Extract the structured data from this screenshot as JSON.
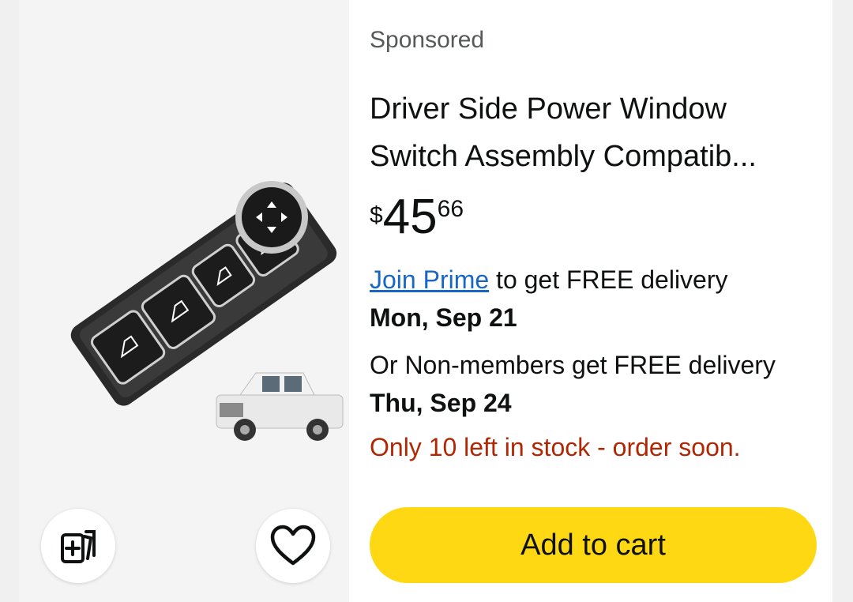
{
  "sponsored_label": "Sponsored",
  "product": {
    "title": "Driver Side Power Window Switch Assembly Compatib...",
    "price": {
      "symbol": "$",
      "whole": "45",
      "fraction": "66"
    },
    "image_alt": "Power window switch assembly"
  },
  "delivery": {
    "join_prime_link": "Join Prime",
    "prime_text": " to get FREE delivery",
    "prime_date": "Mon, Sep 21",
    "non_member_text": "Or Non-members get FREE delivery ",
    "non_member_date": "Thu, Sep 24"
  },
  "stock_message": "Only 10 left in stock - order soon.",
  "buttons": {
    "add_to_cart": "Add to cart",
    "compare_icon": "compare-cards-icon",
    "wishlist_icon": "heart-icon"
  },
  "colors": {
    "cart_button": "#ffd814",
    "link": "#1a66c4",
    "stock_warning": "#b12704",
    "image_background": "#f4f4f4"
  }
}
